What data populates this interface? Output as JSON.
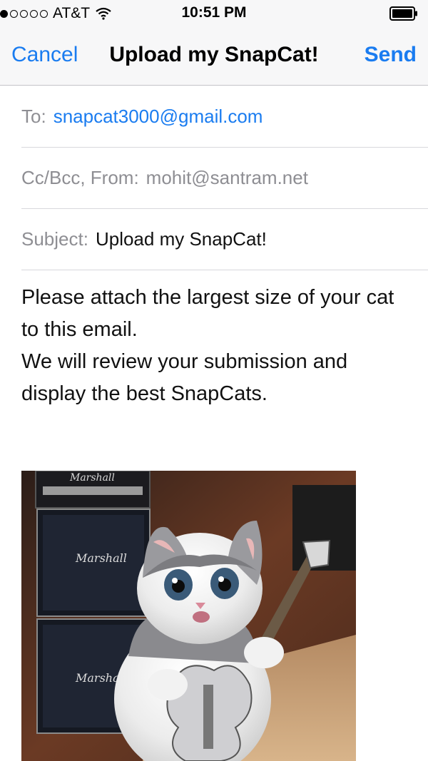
{
  "status_bar": {
    "signal_bars": 1,
    "signal_total": 5,
    "carrier": "AT&T",
    "time": "10:51 PM",
    "wifi_icon": "wifi-icon",
    "battery_icon": "battery-icon"
  },
  "nav": {
    "cancel_label": "Cancel",
    "title": "Upload my SnapCat!",
    "send_label": "Send"
  },
  "fields": {
    "to_label": "To:",
    "to_value": "snapcat3000@gmail.com",
    "cc_label": "Cc/Bcc, From:",
    "cc_value": "mohit@santram.net",
    "subject_label": "Subject:",
    "subject_value": "Upload my SnapCat!"
  },
  "body": {
    "paragraph_1": "Please attach the largest size of your cat to this email.",
    "paragraph_2": "We will review your submission and display the best SnapCats."
  },
  "attachment": {
    "amp_logo_1": "Marshall",
    "amp_logo_2": "Marshall",
    "amp_logo_3": "Marshall"
  },
  "colors": {
    "accent": "#1a7cf0",
    "label_gray": "#8e8e93",
    "divider": "#d8d8dc"
  }
}
